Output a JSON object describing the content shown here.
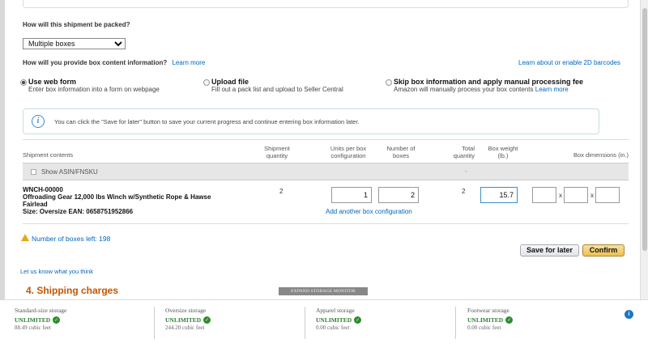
{
  "packing": {
    "question": "How will this shipment be packed?",
    "selected": "Multiple boxes"
  },
  "box_content": {
    "question": "How will you provide box content information?",
    "learn_more": "Learn more",
    "barcodes_link": "Learn about or enable 2D barcodes",
    "options": [
      {
        "title": "Use web form",
        "desc": "Enter box information into a form on webpage",
        "selected": true
      },
      {
        "title": "Upload file",
        "desc": "Fill out a pack list and upload to Seller Central",
        "selected": false
      },
      {
        "title": "Skip box information and apply manual processing fee",
        "desc": "Amazon will manually process your box contents",
        "desc_link": "Learn more",
        "selected": false
      }
    ]
  },
  "info": {
    "icon": "info-icon",
    "text": "You can click the \"Save for later\" button to save your current progress and continue entering box information later."
  },
  "table": {
    "headers": {
      "contents": "Shipment contents",
      "ship_qty": [
        "Shipment",
        "quantity"
      ],
      "units": [
        "Units per box",
        "configuration"
      ],
      "boxes": [
        "Number of",
        "boxes"
      ],
      "total": [
        "Total",
        "quantity"
      ],
      "weight": [
        "Box weight",
        "(lb.)"
      ],
      "dims": "Box dimensions (in.)"
    },
    "show_asin": "Show ASIN/FNSKU",
    "dash": "-",
    "row": {
      "sku": "WNCH-00000",
      "name_line1": "Offroading Gear 12,000 lbs Winch w/Synthetic Rope & Hawse",
      "name_line2": "Fairlead",
      "size": "Size: Oversize EAN: 0658751952866",
      "ship_qty": "2",
      "units": "1",
      "boxes": "2",
      "total": "2",
      "weight": "15.7",
      "add_config": "Add another box configuration",
      "x": "x"
    }
  },
  "boxes_left": "Number of boxes left: 198",
  "buttons": {
    "save": "Save for later",
    "confirm": "Confirm"
  },
  "feedback_link": "Let us know what you think",
  "section4": "4. Shipping charges",
  "expand_label": "EXPAND STORAGE MONITOR",
  "storage": [
    {
      "name": "Standard-size storage",
      "status": "UNLIMITED",
      "sub": "88.49 cubic feet"
    },
    {
      "name": "Oversize storage",
      "status": "UNLIMITED",
      "sub": "244.20 cubic feet"
    },
    {
      "name": "Apparel storage",
      "status": "UNLIMITED",
      "sub": "0.00 cubic feet"
    },
    {
      "name": "Footwear storage",
      "status": "UNLIMITED",
      "sub": "0.00 cubic feet"
    }
  ]
}
